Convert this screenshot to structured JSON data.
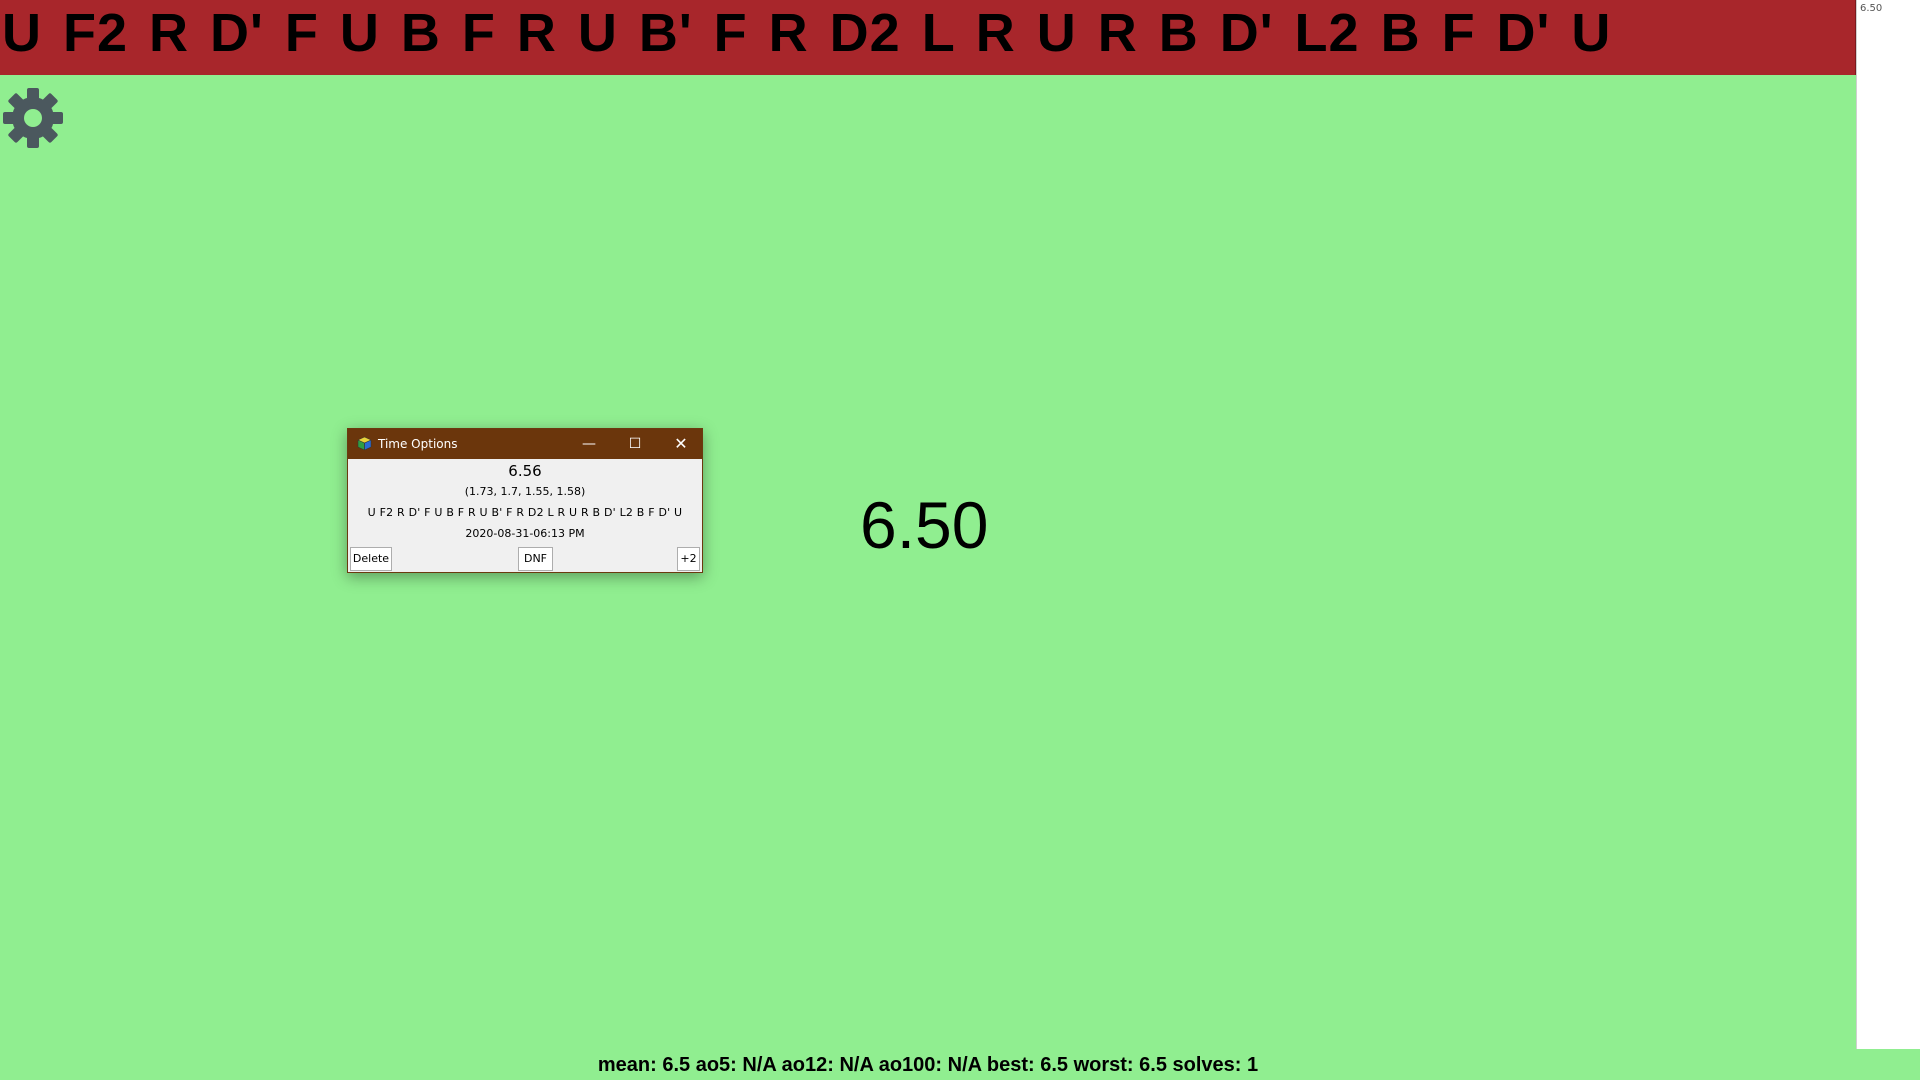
{
  "scramble": "U F2 R D' F U B F R U B' F R D2 L R U R B D' L2 B F D' U",
  "settings": {
    "icon": "gear-icon",
    "color": "#4b585e"
  },
  "history": {
    "items": [
      "6.50"
    ]
  },
  "timer": {
    "current": "6.50"
  },
  "stats": {
    "summary": "mean: 6.5 ao5: N/A ao12: N/A ao100: N/A best: 6.5 worst: 6.5 solves: 1"
  },
  "dialog": {
    "title": "Time Options",
    "time": "6.56",
    "splits": "(1.73, 1.7, 1.55, 1.58)",
    "scramble": "U F2 R D' F U B F R U B' F R D2 L R U R B D' L2 B F D' U",
    "date": "2020-08-31-06:13 PM",
    "buttons": {
      "delete": "Delete",
      "dnf": "DNF",
      "plus2": "+2"
    },
    "window_controls": {
      "minimize": "—",
      "maximize": "☐",
      "close": "✕"
    }
  },
  "colors": {
    "background": "#90ee90",
    "scramble_bar": "#a8262b",
    "dialog_titlebar": "#6b360c"
  }
}
